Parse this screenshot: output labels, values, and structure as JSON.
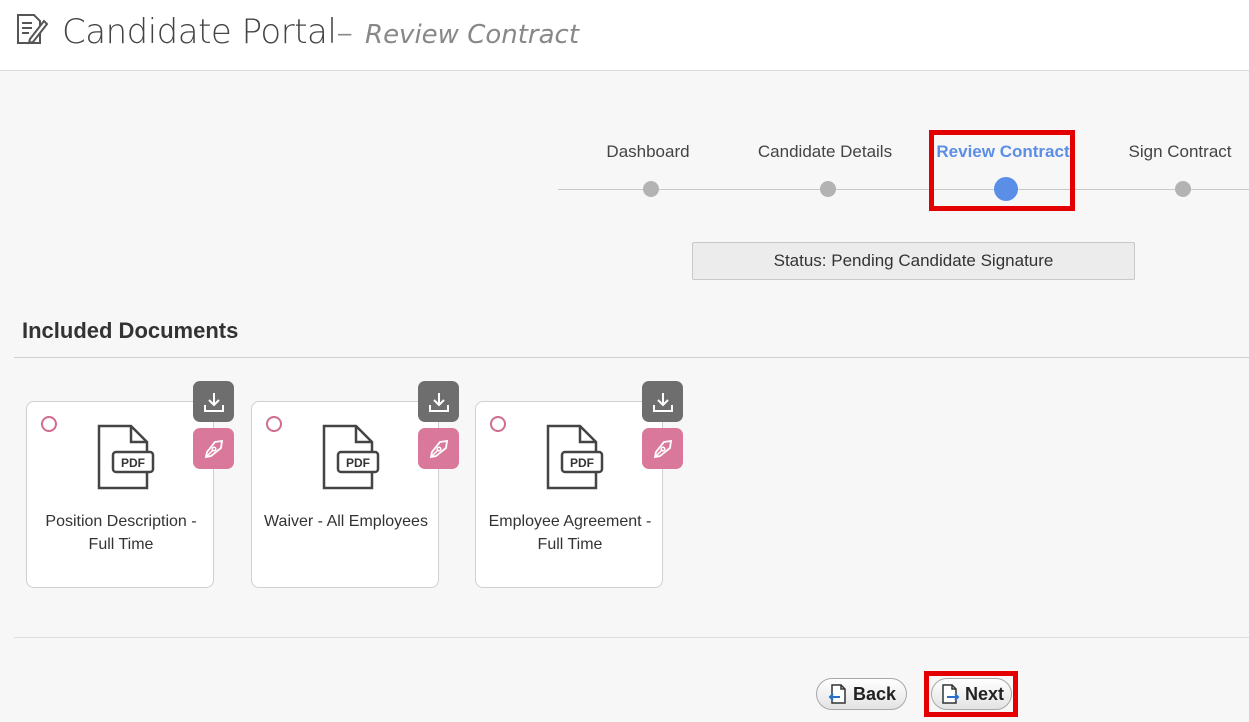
{
  "header": {
    "title": "Candidate Portal",
    "separator": "–",
    "subtitle": "Review Contract",
    "icon": "document-edit-icon"
  },
  "stepper": {
    "steps": [
      {
        "label": "Dashboard",
        "active": false
      },
      {
        "label": "Candidate Details",
        "active": false
      },
      {
        "label": "Review Contract",
        "active": true
      },
      {
        "label": "Sign Contract",
        "active": false
      }
    ],
    "active_color": "#5b8ee6",
    "inactive_color": "#b3b3b3"
  },
  "status": {
    "text": "Status: Pending Candidate Signature"
  },
  "documents_section": {
    "title": "Included Documents",
    "documents": [
      {
        "name": "Position Description - Full Time",
        "icon": "pdf-file-icon"
      },
      {
        "name": "Waiver - All Employees",
        "icon": "pdf-file-icon"
      },
      {
        "name": "Employee Agreement - Full Time",
        "icon": "pdf-file-icon"
      }
    ],
    "pdf_badge": "PDF",
    "download_icon": "download-icon",
    "sign_icon": "pen-nib-icon",
    "sign_color": "#d9789a"
  },
  "footer": {
    "back_label": "Back",
    "next_label": "Next",
    "highlight_color": "#e40000"
  }
}
